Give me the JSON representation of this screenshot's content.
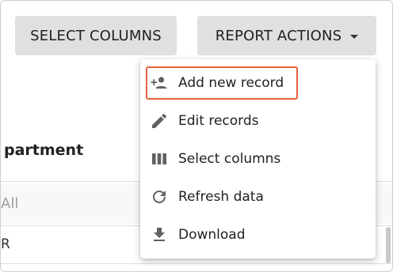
{
  "toolbar": {
    "select_columns_label": "SELECT COLUMNS",
    "report_actions_label": "REPORT ACTIONS"
  },
  "table": {
    "column_header": "partment",
    "filter_value": "All",
    "row_value": "R"
  },
  "menu": {
    "items": [
      {
        "label": "Add new record",
        "icon": "person-add-icon"
      },
      {
        "label": "Edit records",
        "icon": "pencil-icon"
      },
      {
        "label": "Select columns",
        "icon": "columns-icon"
      },
      {
        "label": "Refresh data",
        "icon": "refresh-icon"
      },
      {
        "label": "Download",
        "icon": "download-icon"
      }
    ]
  },
  "colors": {
    "button_bg": "#e0e0e0",
    "highlight_border": "#e8623a",
    "icon_color": "#616161"
  }
}
